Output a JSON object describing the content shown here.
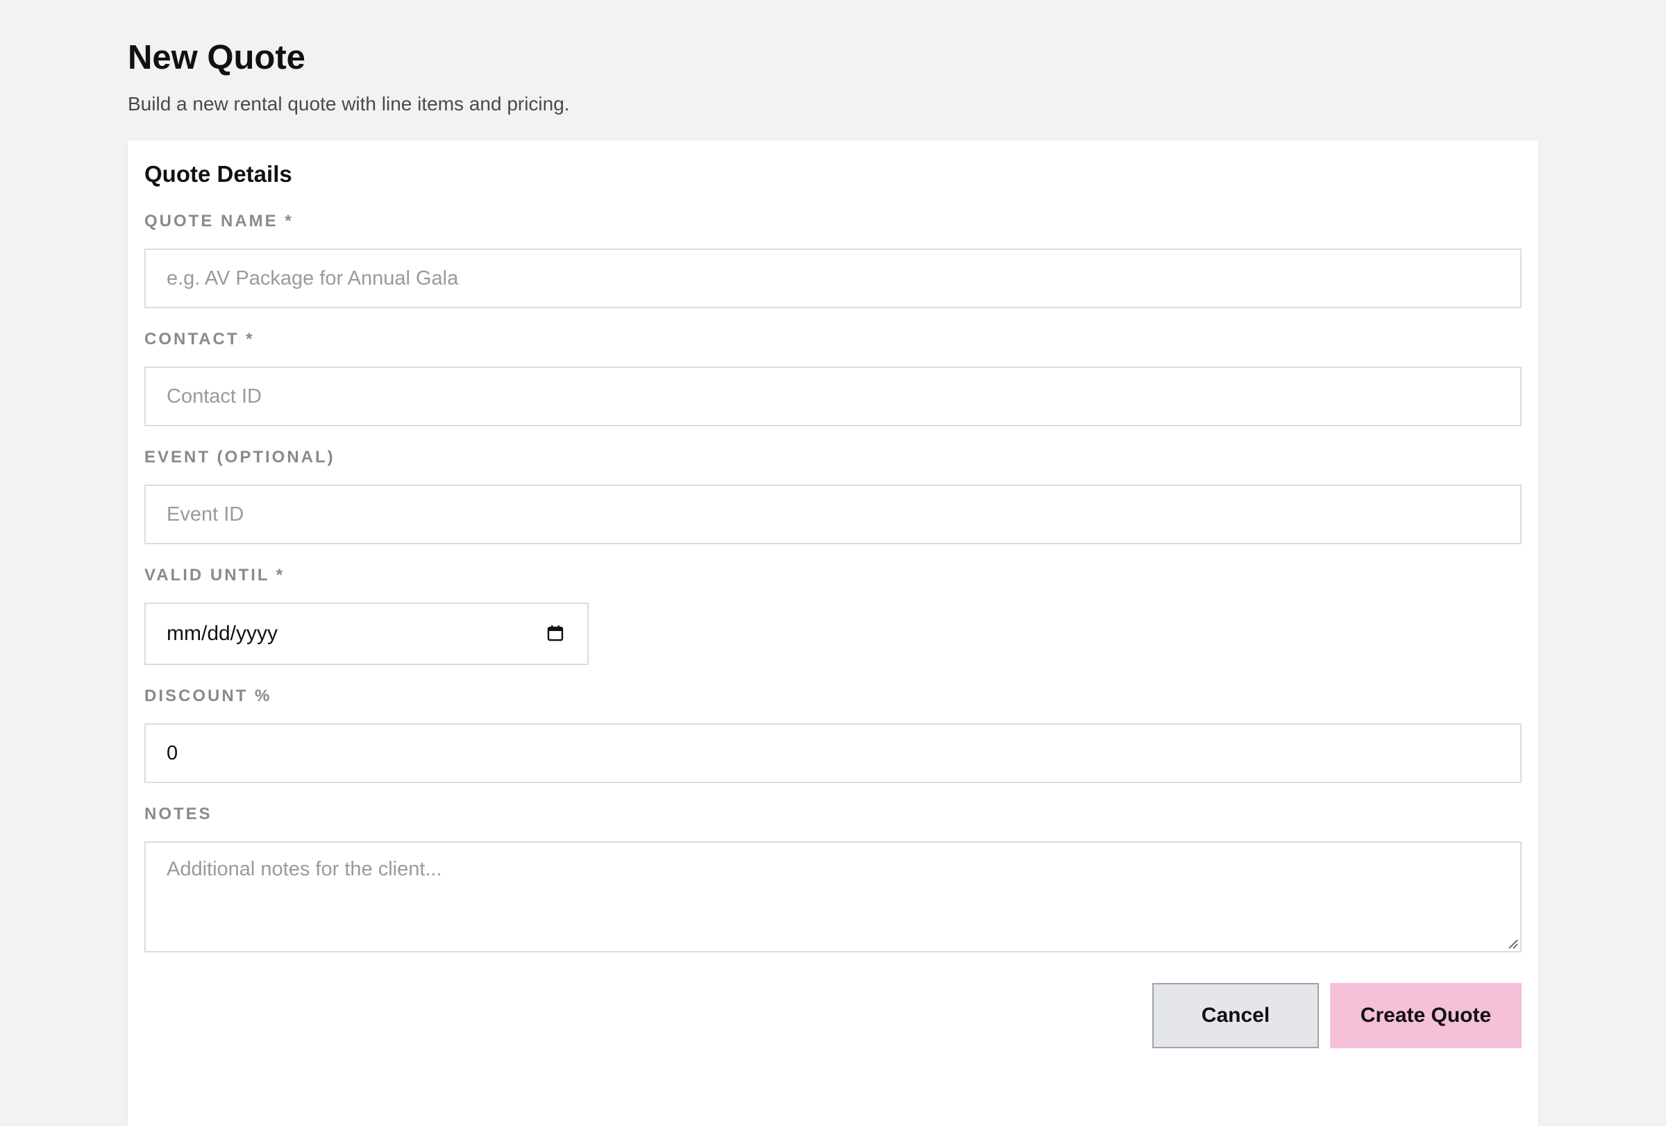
{
  "page": {
    "title": "New Quote",
    "subtitle": "Build a new rental quote with line items and pricing."
  },
  "card": {
    "title": "Quote Details"
  },
  "fields": {
    "quote_name": {
      "label": "QUOTE NAME *",
      "placeholder": "e.g. AV Package for Annual Gala",
      "value": ""
    },
    "contact": {
      "label": "CONTACT *",
      "placeholder": "Contact ID",
      "value": ""
    },
    "event": {
      "label": "EVENT (OPTIONAL)",
      "placeholder": "Event ID",
      "value": ""
    },
    "valid_until": {
      "label": "VALID UNTIL *",
      "display": "mm/dd/yyyy",
      "icon": "calendar-icon"
    },
    "discount": {
      "label": "DISCOUNT %",
      "value": "0"
    },
    "notes": {
      "label": "NOTES",
      "placeholder": "Additional notes for the client...",
      "value": ""
    }
  },
  "actions": {
    "cancel_label": "Cancel",
    "create_label": "Create Quote"
  },
  "colors": {
    "background": "#f2f2f2",
    "card": "#ffffff",
    "primary_button": "#f5c1d8",
    "secondary_button": "#e4e6ea",
    "label": "#8a8a8a"
  }
}
